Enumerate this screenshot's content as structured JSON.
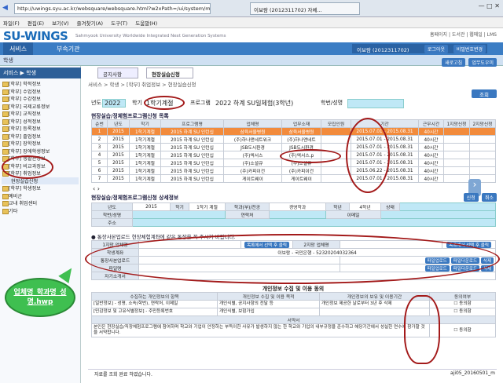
{
  "browser": {
    "url": "http://uwings.syu.ac.kr/websquare/websquare.html?w2xPath=/ui/system/main.xml",
    "tab_title": "이보람 (2012311702) 자체...",
    "window_controls": "— □ ✕"
  },
  "menu": [
    "파일(F)",
    "편집(E)",
    "보기(V)",
    "즐겨찾기(A)",
    "도구(T)",
    "도움말(H)"
  ],
  "header": {
    "logo": "SU-WINGS",
    "logo_sub": "Sahmyook University Worldwide Integrated Next Generation Systems",
    "top_links": "홈페이지 | 도서관 | 웹메일 | LMS",
    "user": "이보람 (2012311702)",
    "user_buttons": [
      "로그아웃",
      "비밀번호변경"
    ],
    "nav_tabs": [
      "서비스",
      "부속기관"
    ],
    "subnav_label": "학생",
    "toolbar_buttons": [
      "새로고침",
      "업무도우미"
    ]
  },
  "sidebar": {
    "title": "서비스 ▶ 학생",
    "items": [
      "[학부] 학적정보",
      "[학부] 수업정보",
      "[학부] 수강정보",
      "[학부] 국제교류정보",
      "[학부] 교직정보",
      "[학부] 성적정보",
      "[학부] 등록정보",
      "[학부] 졸업정보",
      "[학부] 장학정보",
      "[학부] 장애학생정보",
      "[학부] 생활관정보",
      "[학부] 비교과정보",
      "[학부] 취업정보",
      "현장실습신청",
      "[학부] 학생정보",
      "예비군",
      "교내 취업센터",
      "기타"
    ],
    "selected_index": 13
  },
  "main": {
    "tabs": [
      "공지사항",
      "현장실습신청"
    ],
    "breadcrumb": "서비스 > 학생 > [학부] 취업정보 > 현장실습신청",
    "search_button": "조회",
    "filters": {
      "year_label": "년도",
      "year": "2022",
      "term_label": "학기",
      "term": "1학기계절",
      "program_label": "프로그램",
      "program": "2022 하계 SU일체험(3학년)",
      "student_label": "학번/성명"
    },
    "grid_title": "현장실습/정체험프로그램신청 목록",
    "columns": [
      "순번",
      "년도",
      "학기",
      "프로그램명",
      "업체명",
      "업무소재",
      "모집인원",
      "기간",
      "근무시간",
      "1지망신청",
      "2지망신청"
    ],
    "rows": [
      [
        "1",
        "2015",
        "1학기계절",
        "2015 하계 SU 인턴십",
        "삼육서울병원",
        "삼육서울병원",
        "",
        "2015.07.01 - 2015.08.31",
        "40시간",
        "",
        ""
      ],
      [
        "2",
        "2015",
        "1학기계절",
        "2015 하계 SU 인턴십",
        "(주)하나앤네트워크",
        "(주)하나앤네트",
        "",
        "2015.07.01 - 2015.08.31",
        "40시간",
        "",
        ""
      ],
      [
        "3",
        "2015",
        "1학기계절",
        "2015 하계 SU 인턴십",
        "JSB도시환경",
        "JSB도시환경",
        "",
        "2015.07.01 - 2015.08.31",
        "40시간",
        "",
        ""
      ],
      [
        "4",
        "2015",
        "1학기계절",
        "2015 하계 SU 인턴십",
        "(주)엑서스",
        "(주)엑서스.p",
        "",
        "2015.07.01 - 2015.08.31",
        "40시간",
        "",
        ""
      ],
      [
        "5",
        "2015",
        "1학기계절",
        "2015 하계 SU 인턴십",
        "(주)소셜큐",
        "(주)소셜큐",
        "",
        "2015.07.01 - 2015.08.31",
        "40시간",
        "",
        ""
      ],
      [
        "6",
        "2015",
        "1학기계절",
        "2015 하계 SU 인턴십",
        "(주)카피이건",
        "(주)카피이건",
        "",
        "2015.06.22 - 2015.08.31",
        "40시간",
        "",
        ""
      ],
      [
        "7",
        "2015",
        "1학기계절",
        "2015 하계 SU 인턴십",
        "게이트웨이",
        "게이트웨이",
        "",
        "2015.07.01 - 2015.08.31",
        "40시간",
        "",
        ""
      ]
    ],
    "selected_row": 0,
    "detail_title": "현장실습/정체험프로그램신청 상세정보",
    "detail_buttons": [
      "신청",
      "취소"
    ],
    "detail": {
      "year_label": "년도",
      "year": "2015",
      "term_label": "학기",
      "term": "1학기 계절",
      "dept_label": "학과(부)/전공",
      "dept": "경영학과",
      "grade_label": "학년",
      "grade": "4학년",
      "status_label": "상태",
      "name_label": "학번/성명",
      "phone_label": "연락처",
      "email_label": "이메일",
      "addr_label": "주소"
    },
    "notice": "● 통장사본업로드 현장체험계좌에 같은 통장을 꼭 주시기 바랍니다.",
    "work": {
      "choice1_label": "1지망 업체명",
      "choice1_btn": "목록에서 선택 후 클릭",
      "choice2_label": "2지망 업체명",
      "choice2_btn": "목록에서 선택 후 클릭",
      "account_label": "학생계좌",
      "account": "이보람 - 국민은행 - 52320204032364",
      "bank_label": "통장사본업로드",
      "files_label": "파일명",
      "intro_label": "자기소개서",
      "upload_btn": "파일업로드",
      "download_btn": "파일다운로드",
      "delete_btn": "삭제"
    },
    "consent": {
      "title": "개인정보 수집 및 이용 동의",
      "headers": [
        "수집하는 개인정보의 항목",
        "개인정보 수집 및 이용 목적",
        "개인정보의 보유 및 이용기간",
        "동의여부"
      ],
      "rows": [
        [
          "[일반정보] - 성명, 소속(학번), 연락처, 이메일",
          "개인식별, 공지사항의 전달 등",
          "개인정보 제공한 날로부터 3년 후 삭제",
          "동의함"
        ],
        [
          "[민감정보 및 고유식별정보] - 주민등록번호",
          "개인식별, 보험가입",
          "",
          "동의함"
        ]
      ],
      "pledge_title": "서약서",
      "pledge": "본인은 현장실습/직장체험프로그램에 참여하며 학교와 기업이 안정하는 부득이한 사유가 발생하지 않는 한 학교와 기업의 내부규정을 준수하고 해당기간에서 성실한 연수에 참가할 것을 서약합니다.",
      "pledge_check": "동의함"
    },
    "footer_msg": "자료를 조회 완료 하였습니다.",
    "footer_id": "aji05_20160501_m"
  },
  "annotation": "업체명_학과명_성명.hwp"
}
